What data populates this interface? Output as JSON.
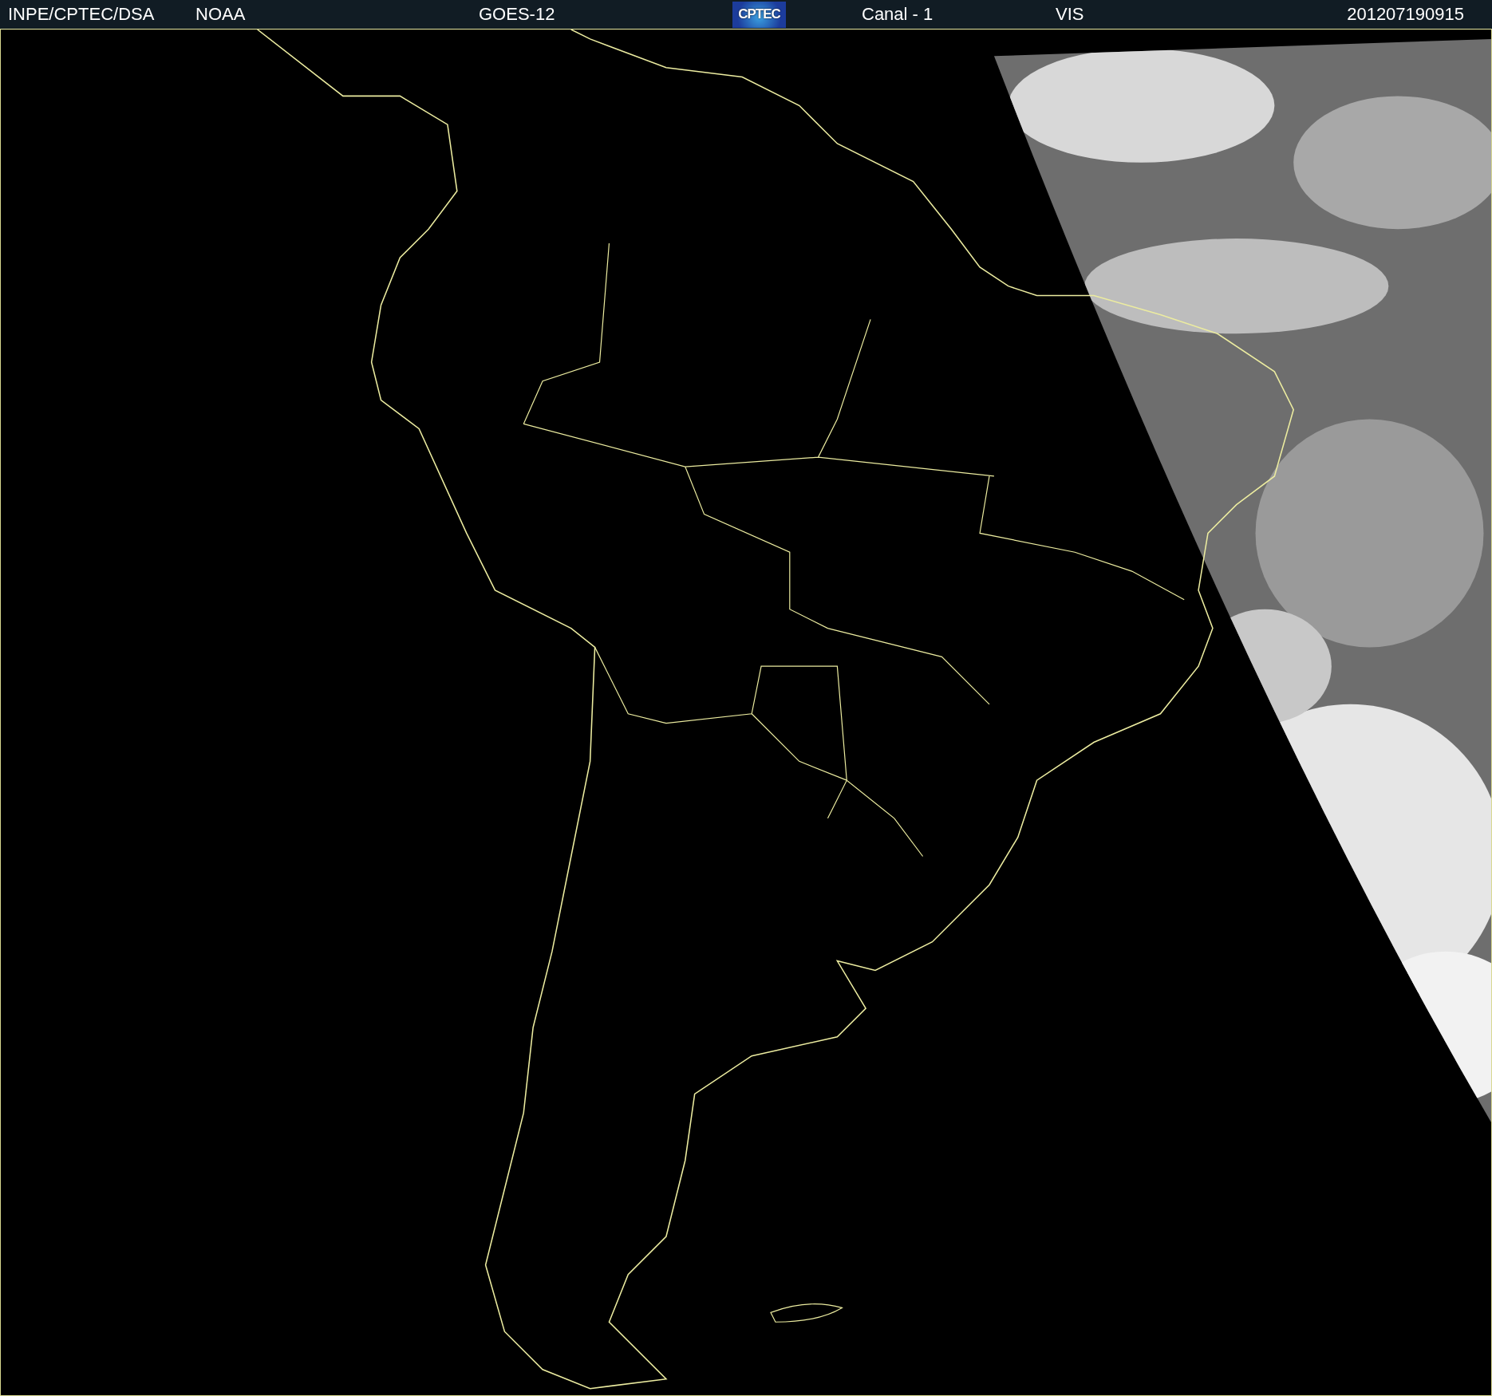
{
  "header": {
    "items": [
      {
        "kind": "text",
        "label": "INPE/CPTEC/DSA"
      },
      {
        "kind": "text",
        "label": "NOAA"
      },
      {
        "kind": "text",
        "label": "GOES-12"
      },
      {
        "kind": "logo",
        "label": "CPTEC"
      },
      {
        "kind": "text",
        "label": "Canal - 1"
      },
      {
        "kind": "text",
        "label": "VIS"
      },
      {
        "kind": "text",
        "label": "201207190915"
      }
    ]
  }
}
